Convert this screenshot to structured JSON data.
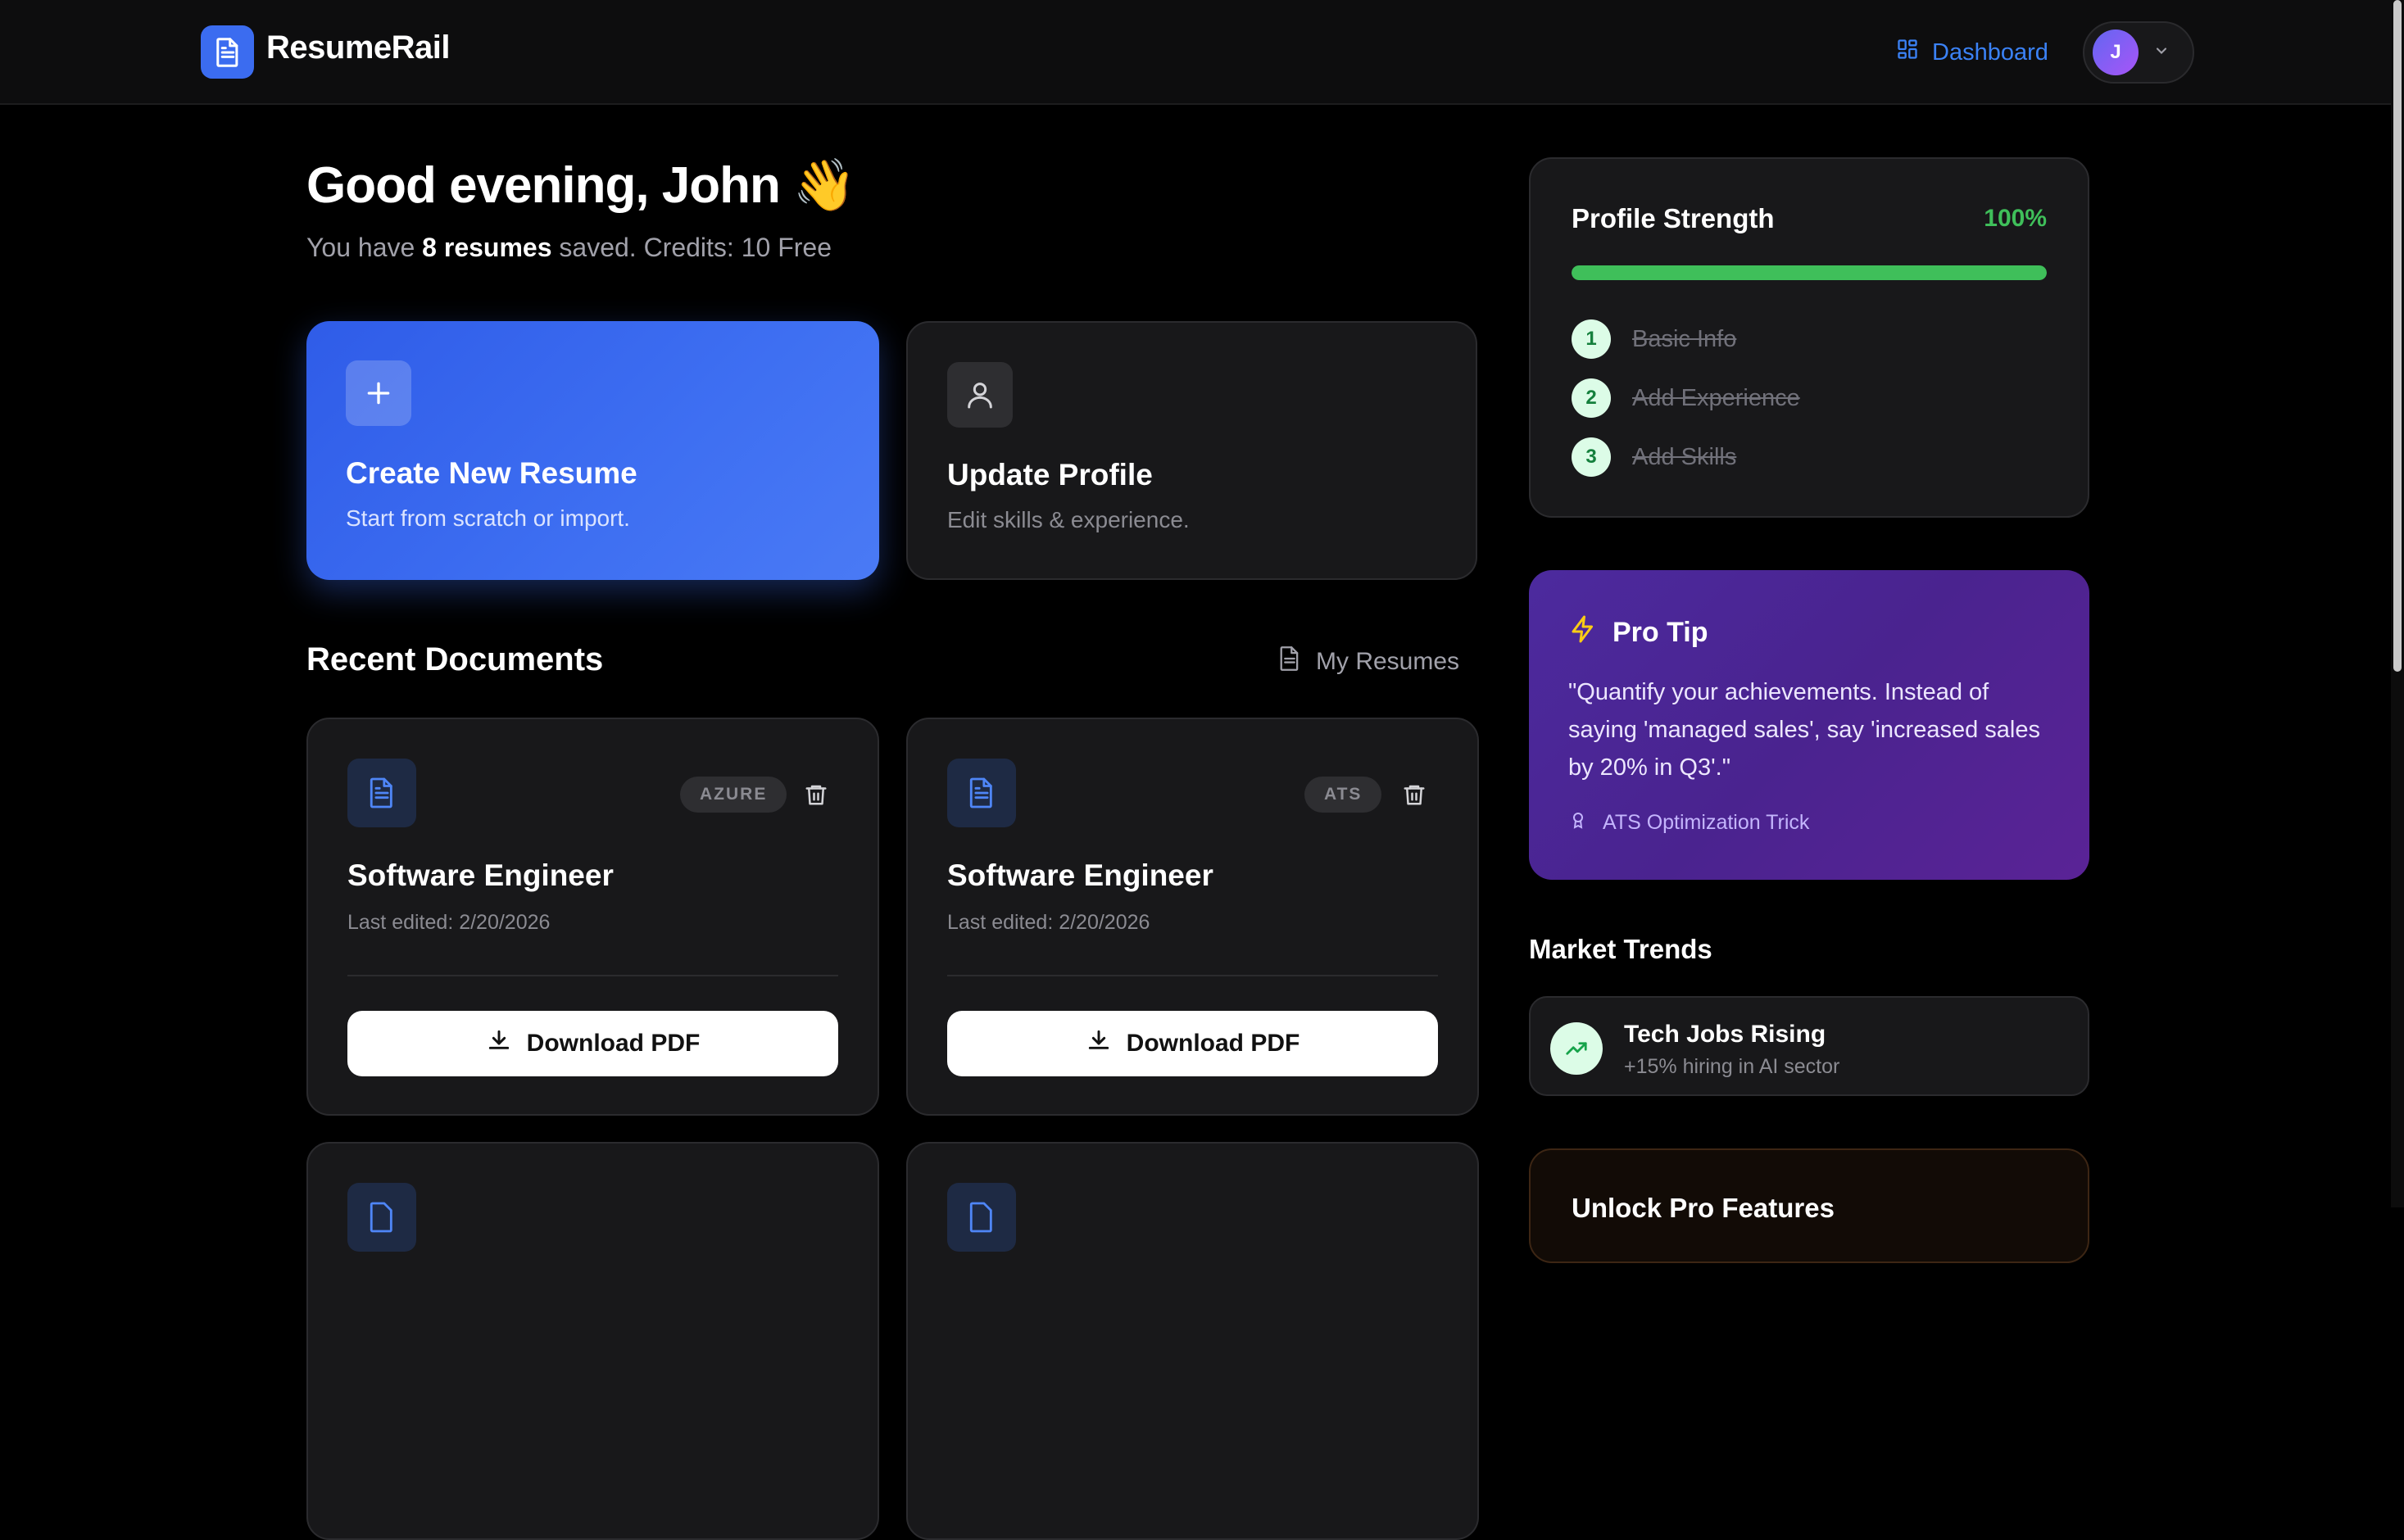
{
  "header": {
    "brand": "ResumeRail",
    "nav_dashboard": "Dashboard",
    "avatar_initial": "J",
    "accent_color": "#3b82f6"
  },
  "greeting": {
    "title": "Good evening, John",
    "emoji": "👋",
    "sub_prefix": "You have ",
    "sub_count": "8 resumes",
    "sub_suffix": " saved. Credits: 10 Free"
  },
  "actions": {
    "create": {
      "title": "Create New Resume",
      "desc": "Start from scratch or import.",
      "icon": "plus-icon"
    },
    "update": {
      "title": "Update Profile",
      "desc": "Edit skills & experience.",
      "icon": "user-icon"
    }
  },
  "recent": {
    "title": "Recent Documents",
    "link": "My Resumes",
    "documents": [
      {
        "title": "Software Engineer",
        "date": "Last edited: 2/20/2026",
        "badge": "AZURE",
        "button": "Download PDF"
      },
      {
        "title": "Software Engineer",
        "date": "Last edited: 2/20/2026",
        "badge": "ATS",
        "button": "Download PDF"
      }
    ]
  },
  "profile_strength": {
    "title": "Profile Strength",
    "percent_label": "100%",
    "progress": 1.0,
    "steps": [
      {
        "num": "1",
        "label": "Basic Info"
      },
      {
        "num": "2",
        "label": "Add Experience"
      },
      {
        "num": "3",
        "label": "Add Skills"
      }
    ]
  },
  "pro_tip": {
    "title": "Pro Tip",
    "quote": "\"Quantify your achievements. Instead of saying 'managed sales', say 'increased sales by 20% in Q3'.\"",
    "tag": "ATS Optimization Trick"
  },
  "market": {
    "title": "Market Trends",
    "trend_title": "Tech Jobs Rising",
    "trend_sub": "+15% hiring in AI sector"
  },
  "unlock": {
    "title": "Unlock Pro Features"
  }
}
